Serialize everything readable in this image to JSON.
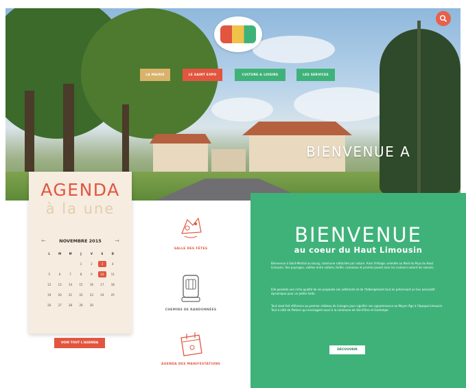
{
  "header": {
    "nav": [
      "LA MAIRIE",
      "LE SAINT EXPO",
      "CULTURE & LOISIRS",
      "LES SERVICES"
    ],
    "search_icon": "search-icon",
    "logo": "village-logo"
  },
  "hero": {
    "title": "BIENVENUE A"
  },
  "agenda": {
    "title": "AGENDA",
    "subtitle": "à la une",
    "month": "NOVEMBRE 2015",
    "prev_icon": "arrow-left-icon",
    "next_icon": "arrow-right-icon",
    "days": [
      "L",
      "M",
      "M",
      "J",
      "V",
      "S",
      "D"
    ],
    "weeks": [
      [
        "",
        "",
        "",
        "1",
        "2",
        "3",
        "4"
      ],
      [
        "5",
        "6",
        "7",
        "8",
        "9",
        "10",
        "11"
      ],
      [
        "12",
        "13",
        "14",
        "15",
        "16",
        "17",
        "18"
      ],
      [
        "19",
        "20",
        "21",
        "22",
        "23",
        "24",
        "25"
      ],
      [
        "26",
        "27",
        "28",
        "29",
        "30",
        "",
        ""
      ]
    ],
    "highlighted": [
      "3",
      "10"
    ],
    "button": "VOIR TOUT L'AGENDA"
  },
  "features": [
    {
      "label": "SALLE DES FÊTES",
      "icon": "hall-icon",
      "color": "#e2553f"
    },
    {
      "label": "CHEMINS DE RANDONNÉES",
      "icon": "trail-icon",
      "color": "#6b6b6b"
    },
    {
      "label": "AGENDA DES MANIFESTATIONS",
      "icon": "calendar-icon",
      "color": "#e2553f"
    }
  ],
  "welcome": {
    "title": "BIENVENUE",
    "subtitle": "au coeur du Haut Limousin",
    "paragraphs": [
      "Bienvenue à Saint-Martial au bourg, commune rattachée par nature. Ainsi d'étiage, orientée au Nord du Pays du Haut Limousin. Ses paysages, vallées entre vallons, forêts, ruisseaux et prairies jouent avec les couleurs autant les saisons.",
      "Elle possède une riche qualité de vie proposée ses adhérents et de l'hébergement tout en préservant un lieu associatif dynamique pour un petite halte.",
      "Tout vient fait référence au premier château de Limoges pour signifier son appartenance au Moyen Âge à l'époque Limousin. Tout à côté de Poitiers qui envisagent aussi à la commune de Val-d'Oise et Gartempe."
    ],
    "button": "DÉCOUVRIR"
  },
  "colors": {
    "accent_red": "#e2553f",
    "accent_green": "#3fb27a",
    "accent_gold": "#d9b36b",
    "agenda_bg": "#f6ece0"
  }
}
